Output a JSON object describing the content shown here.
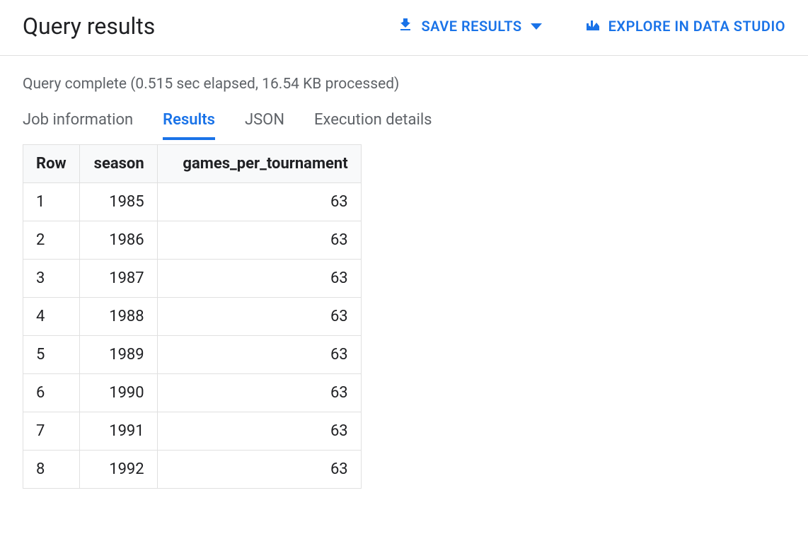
{
  "header": {
    "title": "Query results",
    "save_label": "SAVE RESULTS",
    "explore_label": "EXPLORE IN DATA STUDIO"
  },
  "status": "Query complete (0.515 sec elapsed, 16.54 KB processed)",
  "tabs": {
    "job_info": "Job information",
    "results": "Results",
    "json": "JSON",
    "exec": "Execution details"
  },
  "table": {
    "columns": {
      "row": "Row",
      "season": "season",
      "games": "games_per_tournament"
    },
    "rows": [
      {
        "row": "1",
        "season": "1985",
        "games": "63"
      },
      {
        "row": "2",
        "season": "1986",
        "games": "63"
      },
      {
        "row": "3",
        "season": "1987",
        "games": "63"
      },
      {
        "row": "4",
        "season": "1988",
        "games": "63"
      },
      {
        "row": "5",
        "season": "1989",
        "games": "63"
      },
      {
        "row": "6",
        "season": "1990",
        "games": "63"
      },
      {
        "row": "7",
        "season": "1991",
        "games": "63"
      },
      {
        "row": "8",
        "season": "1992",
        "games": "63"
      }
    ]
  }
}
